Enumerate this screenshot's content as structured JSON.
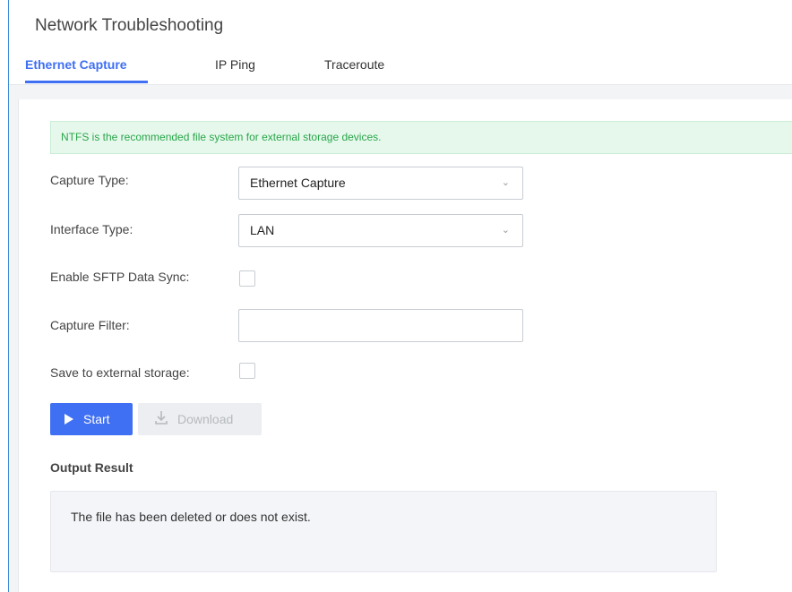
{
  "page": {
    "title": "Network Troubleshooting"
  },
  "tabs": [
    {
      "label": "Ethernet Capture",
      "active": true
    },
    {
      "label": "IP Ping",
      "active": false
    },
    {
      "label": "Traceroute",
      "active": false
    }
  ],
  "notice": {
    "text": "NTFS is the recommended file system for external storage devices."
  },
  "form": {
    "capture_type": {
      "label": "Capture Type:",
      "value": "Ethernet Capture"
    },
    "interface_type": {
      "label": "Interface Type:",
      "value": "LAN"
    },
    "sftp_sync": {
      "label": "Enable SFTP Data Sync:",
      "checked": false
    },
    "capture_filter": {
      "label": "Capture Filter:",
      "value": ""
    },
    "external_storage": {
      "label": "Save to external storage:",
      "checked": false
    }
  },
  "actions": {
    "start_label": "Start",
    "download_label": "Download"
  },
  "output": {
    "title": "Output Result",
    "text": "The file has been deleted or does not exist."
  },
  "colors": {
    "accent": "#3f6ff2",
    "notice_bg": "#e6f8ec",
    "notice_text": "#2aa64a",
    "frame_line": "#3d8bd8"
  }
}
